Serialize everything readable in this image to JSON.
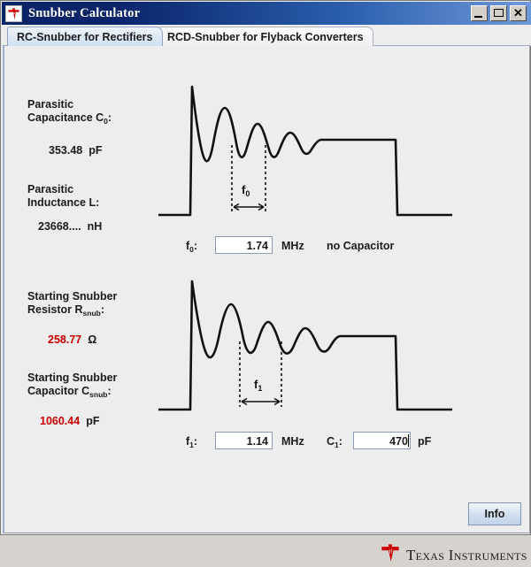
{
  "window": {
    "title": "Snubber Calculator",
    "app_icon": "ti-logo-icon",
    "controls": {
      "minimize": "minimize-icon",
      "maximize": "maximize-icon",
      "close": "close-icon"
    }
  },
  "tabs": [
    {
      "label": "RC-Snubber for Rectifiers",
      "active": true
    },
    {
      "label": "RCD-Snubber for Flyback Converters",
      "active": false
    }
  ],
  "results": {
    "parasitic_capacitance": {
      "label_line1": "Parasitic",
      "label_line2_pre": "Capacitance C",
      "label_sub": "0",
      "label_post": ":",
      "value": "353.48",
      "unit": "pF"
    },
    "parasitic_inductance": {
      "label_line1": "Parasitic",
      "label_line2": "Inductance L:",
      "value": "23668....",
      "unit": "nH"
    },
    "starting_snubber_resistor": {
      "label_line1": "Starting Snubber",
      "label_line2_pre": "Resistor R",
      "label_sub": "snub",
      "label_post": ":",
      "value": "258.77",
      "unit": "Ω"
    },
    "starting_snubber_capacitor": {
      "label_line1": "Starting Snubber",
      "label_line2_pre": "Capacitor C",
      "label_sub": "snub",
      "label_post": ":",
      "value": "1060.44",
      "unit": "pF"
    }
  },
  "graphs": {
    "top": {
      "annotation_pre": "f",
      "annotation_sub": "0",
      "name": "ringing-waveform-undamped"
    },
    "bottom": {
      "annotation_pre": "f",
      "annotation_sub": "1",
      "name": "ringing-waveform-damped"
    }
  },
  "row_f0": {
    "field_label_pre": "f",
    "field_label_sub": "0",
    "field_label_post": ":",
    "value": "1.74",
    "placeholder": "",
    "unit": "MHz",
    "note": "no Capacitor"
  },
  "row_f1": {
    "field_label_pre": "f",
    "field_label_sub": "1",
    "field_label_post": ":",
    "value": "1.14",
    "placeholder": "",
    "unit": "MHz",
    "cap_label_pre": "C",
    "cap_label_sub": "1",
    "cap_label_post": ":",
    "cap_value": "470",
    "cap_placeholder": "",
    "cap_unit": "pF"
  },
  "info_button": {
    "label": "Info"
  },
  "footer": {
    "brand": "Texas Instruments",
    "logo": "ti-logo-icon"
  },
  "colors": {
    "accent_red": "#cc0000",
    "title_blue": "#0a246a",
    "panel_bg": "#ededed",
    "tab_active": "#cfe0f2"
  }
}
